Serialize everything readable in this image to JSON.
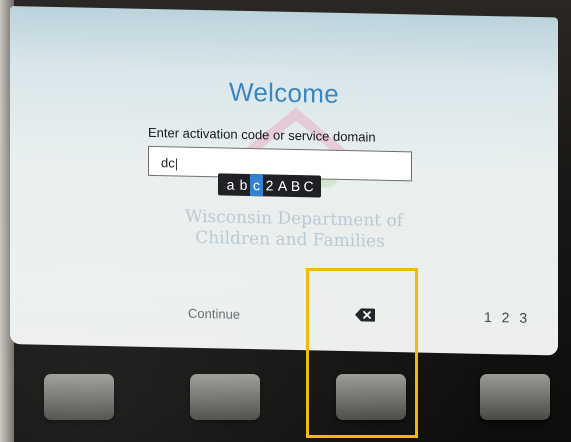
{
  "screen": {
    "title": "Welcome",
    "prompt": "Enter activation code or service domain",
    "input_value": "dc",
    "watermark": {
      "line1": "Wisconsin Department of",
      "line2": "Children and Families"
    },
    "predictive_chars": [
      "a",
      "b",
      "c",
      "2",
      "A",
      "B",
      "C"
    ],
    "selected_char_index": 2
  },
  "softkeys": {
    "left_label": "Continue",
    "middle_icon": "backspace-icon",
    "right_label": "1 2 3"
  },
  "colors": {
    "title": "#3a86c2",
    "highlight": "#f2b705",
    "selected_char": "#2f7fd0"
  }
}
